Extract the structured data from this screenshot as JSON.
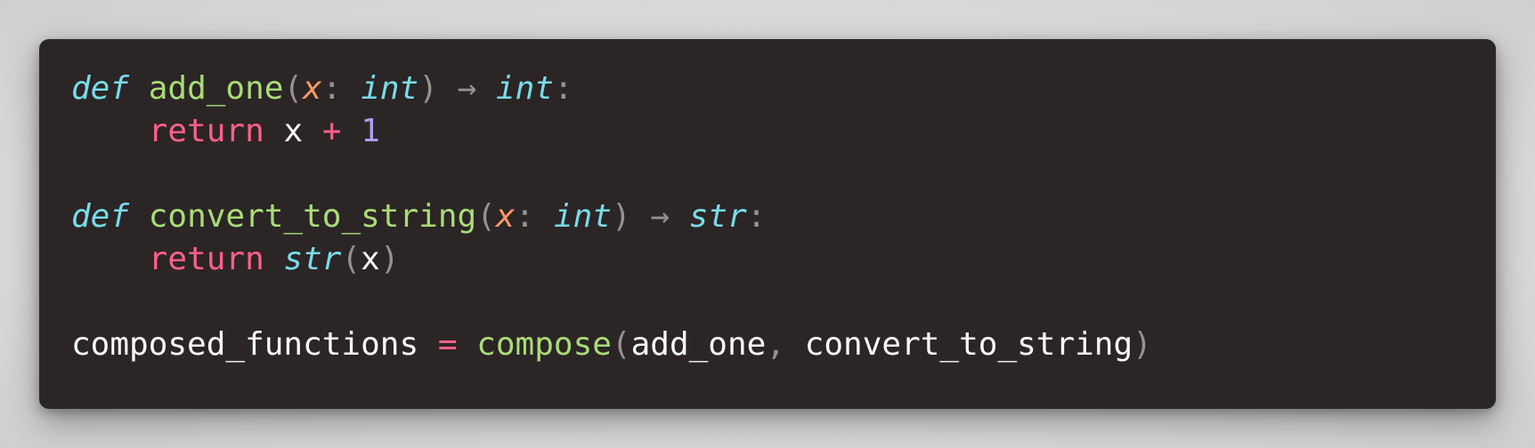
{
  "code": {
    "line1": {
      "keyword": "def",
      "name": "add_one",
      "open_paren": "(",
      "param": "x",
      "colon": ":",
      "param_type": "int",
      "close_paren": ")",
      "arrow": "→",
      "return_type": "int",
      "end_colon": ":"
    },
    "line2": {
      "keyword": "return",
      "var": "x",
      "op": "+",
      "num": "1"
    },
    "line4": {
      "keyword": "def",
      "name": "convert_to_string",
      "open_paren": "(",
      "param": "x",
      "colon": ":",
      "param_type": "int",
      "close_paren": ")",
      "arrow": "→",
      "return_type": "str",
      "end_colon": ":"
    },
    "line5": {
      "keyword": "return",
      "builtin": "str",
      "open_paren": "(",
      "arg": "x",
      "close_paren": ")"
    },
    "line7": {
      "var": "composed_functions",
      "op": "=",
      "fn": "compose",
      "open_paren": "(",
      "arg1": "add_one",
      "comma": ",",
      "arg2": "convert_to_string",
      "close_paren": ")"
    }
  },
  "colors": {
    "background": "#2b2526",
    "keyword_def": "#78dce8",
    "function": "#a9dc76",
    "parameter": "#fc9867",
    "type": "#78dce8",
    "keyword_return": "#ff6188",
    "number": "#ab9df2",
    "punctuation": "#939293",
    "identifier": "#fcfcfa"
  }
}
